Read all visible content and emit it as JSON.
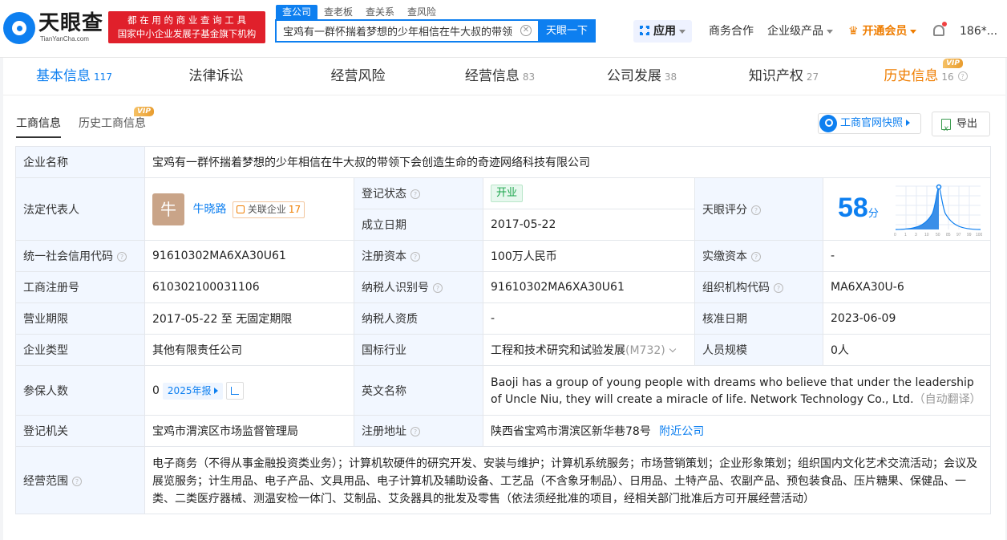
{
  "header": {
    "logo_name": "天眼查",
    "logo_url": "TianYanCha.com",
    "badge_line1": "都 在 用 的 商 业 查 询 工 具",
    "badge_line2": "国家中小企业发展子基金旗下机构",
    "search_tabs": [
      "查公司",
      "查老板",
      "查关系",
      "查风险"
    ],
    "search_value": "宝鸡有一群怀揣着梦想的少年相信在牛大叔的带领下会",
    "search_button": "天眼一下",
    "nav_app": "应用",
    "nav_business": "商务合作",
    "nav_enterprise": "企业级产品",
    "nav_vip": "开通会员",
    "user": "186*...",
    "colors": {
      "brand": "#0d7ff0",
      "badge_red": "#e0202b",
      "vip": "#ef7d00"
    }
  },
  "tabs": [
    {
      "label": "基本信息",
      "count": "117"
    },
    {
      "label": "法律诉讼",
      "count": ""
    },
    {
      "label": "经营风险",
      "count": ""
    },
    {
      "label": "经营信息",
      "count": "83"
    },
    {
      "label": "公司发展",
      "count": "38"
    },
    {
      "label": "知识产权",
      "count": "27"
    },
    {
      "label": "历史信息",
      "count": "16"
    }
  ],
  "vip_label": "VIP",
  "subtabs": {
    "active": "工商信息",
    "other": "历史工商信息"
  },
  "snapshot_button": "工商官网快照",
  "export_button": "导出",
  "info": {
    "company_name_label": "企业名称",
    "company_name": "宝鸡有一群怀揣着梦想的少年相信在牛大叔的带领下会创造生命的奇迹网络科技有限公司",
    "legal_rep_label": "法定代表人",
    "legal_rep_avatar": "牛",
    "legal_rep": "牛晓路",
    "related_label": "关联企业",
    "related_count": "17",
    "reg_status_label": "登记状态",
    "reg_status": "开业",
    "found_date_label": "成立日期",
    "found_date": "2017-05-22",
    "score_label": "天眼评分",
    "score": "58",
    "score_unit": "分",
    "score_ticks": [
      "0",
      "1",
      "3",
      "10",
      "50",
      "85",
      "97",
      "99",
      "100"
    ],
    "credit_code_label": "统一社会信用代码",
    "credit_code": "91610302MA6XA30U61",
    "reg_capital_label": "注册资本",
    "reg_capital": "100万人民币",
    "paid_capital_label": "实缴资本",
    "paid_capital": "-",
    "reg_no_label": "工商注册号",
    "reg_no": "610302100031106",
    "taxpayer_id_label": "纳税人识别号",
    "taxpayer_id": "91610302MA6XA30U61",
    "org_code_label": "组织机构代码",
    "org_code": "MA6XA30U-6",
    "term_label": "营业期限",
    "term": "2017-05-22 至 无固定期限",
    "taxpayer_qual_label": "纳税人资质",
    "taxpayer_qual": "-",
    "approve_date_label": "核准日期",
    "approve_date": "2023-06-09",
    "type_label": "企业类型",
    "type": "其他有限责任公司",
    "industry_label": "国标行业",
    "industry": "工程和技术研究和试验发展",
    "industry_code": "(M732)",
    "staff_label": "人员规模",
    "staff": "0人",
    "insured_label": "参保人数",
    "insured": "0",
    "insured_report": "2025年报",
    "english_label": "英文名称",
    "english_name": "Baoji has a group of young people with dreams who believe that under the leadership of Uncle Niu, they will create a miracle of life. Network Technology Co., Ltd.",
    "auto_translate": "（自动翻译）",
    "authority_label": "登记机关",
    "authority": "宝鸡市渭滨区市场监督管理局",
    "address_label": "注册地址",
    "address": "陕西省宝鸡市渭滨区新华巷78号",
    "nearby": "附近公司",
    "scope_label": "经营范围",
    "scope": "电子商务（不得从事金融投资类业务）；计算机软硬件的研究开发、安装与维护；计算机系统服务；市场营销策划；企业形象策划；组织国内文化艺术交流活动；会议及展览服务；计生用品、电子产品、文具用品、电子计算机及辅助设备、工艺品（不含象牙制品）、日用品、土特产品、农副产品、预包装食品、压片糖果、保健品、一类、二类医疗器械、测温安检一体门、艾制品、艾灸器具的批发及零售（依法须经批准的项目，经相关部门批准后方可开展经营活动）"
  }
}
